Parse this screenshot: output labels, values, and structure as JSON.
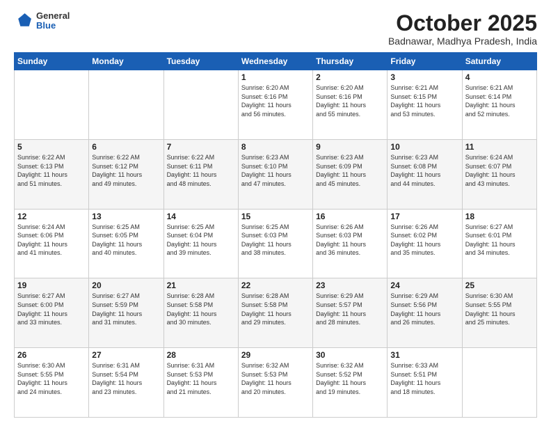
{
  "header": {
    "logo_general": "General",
    "logo_blue": "Blue",
    "month_title": "October 2025",
    "location": "Badnawar, Madhya Pradesh, India"
  },
  "days_of_week": [
    "Sunday",
    "Monday",
    "Tuesday",
    "Wednesday",
    "Thursday",
    "Friday",
    "Saturday"
  ],
  "weeks": [
    [
      {
        "day": "",
        "info": ""
      },
      {
        "day": "",
        "info": ""
      },
      {
        "day": "",
        "info": ""
      },
      {
        "day": "1",
        "info": "Sunrise: 6:20 AM\nSunset: 6:16 PM\nDaylight: 11 hours\nand 56 minutes."
      },
      {
        "day": "2",
        "info": "Sunrise: 6:20 AM\nSunset: 6:16 PM\nDaylight: 11 hours\nand 55 minutes."
      },
      {
        "day": "3",
        "info": "Sunrise: 6:21 AM\nSunset: 6:15 PM\nDaylight: 11 hours\nand 53 minutes."
      },
      {
        "day": "4",
        "info": "Sunrise: 6:21 AM\nSunset: 6:14 PM\nDaylight: 11 hours\nand 52 minutes."
      }
    ],
    [
      {
        "day": "5",
        "info": "Sunrise: 6:22 AM\nSunset: 6:13 PM\nDaylight: 11 hours\nand 51 minutes."
      },
      {
        "day": "6",
        "info": "Sunrise: 6:22 AM\nSunset: 6:12 PM\nDaylight: 11 hours\nand 49 minutes."
      },
      {
        "day": "7",
        "info": "Sunrise: 6:22 AM\nSunset: 6:11 PM\nDaylight: 11 hours\nand 48 minutes."
      },
      {
        "day": "8",
        "info": "Sunrise: 6:23 AM\nSunset: 6:10 PM\nDaylight: 11 hours\nand 47 minutes."
      },
      {
        "day": "9",
        "info": "Sunrise: 6:23 AM\nSunset: 6:09 PM\nDaylight: 11 hours\nand 45 minutes."
      },
      {
        "day": "10",
        "info": "Sunrise: 6:23 AM\nSunset: 6:08 PM\nDaylight: 11 hours\nand 44 minutes."
      },
      {
        "day": "11",
        "info": "Sunrise: 6:24 AM\nSunset: 6:07 PM\nDaylight: 11 hours\nand 43 minutes."
      }
    ],
    [
      {
        "day": "12",
        "info": "Sunrise: 6:24 AM\nSunset: 6:06 PM\nDaylight: 11 hours\nand 41 minutes."
      },
      {
        "day": "13",
        "info": "Sunrise: 6:25 AM\nSunset: 6:05 PM\nDaylight: 11 hours\nand 40 minutes."
      },
      {
        "day": "14",
        "info": "Sunrise: 6:25 AM\nSunset: 6:04 PM\nDaylight: 11 hours\nand 39 minutes."
      },
      {
        "day": "15",
        "info": "Sunrise: 6:25 AM\nSunset: 6:03 PM\nDaylight: 11 hours\nand 38 minutes."
      },
      {
        "day": "16",
        "info": "Sunrise: 6:26 AM\nSunset: 6:03 PM\nDaylight: 11 hours\nand 36 minutes."
      },
      {
        "day": "17",
        "info": "Sunrise: 6:26 AM\nSunset: 6:02 PM\nDaylight: 11 hours\nand 35 minutes."
      },
      {
        "day": "18",
        "info": "Sunrise: 6:27 AM\nSunset: 6:01 PM\nDaylight: 11 hours\nand 34 minutes."
      }
    ],
    [
      {
        "day": "19",
        "info": "Sunrise: 6:27 AM\nSunset: 6:00 PM\nDaylight: 11 hours\nand 33 minutes."
      },
      {
        "day": "20",
        "info": "Sunrise: 6:27 AM\nSunset: 5:59 PM\nDaylight: 11 hours\nand 31 minutes."
      },
      {
        "day": "21",
        "info": "Sunrise: 6:28 AM\nSunset: 5:58 PM\nDaylight: 11 hours\nand 30 minutes."
      },
      {
        "day": "22",
        "info": "Sunrise: 6:28 AM\nSunset: 5:58 PM\nDaylight: 11 hours\nand 29 minutes."
      },
      {
        "day": "23",
        "info": "Sunrise: 6:29 AM\nSunset: 5:57 PM\nDaylight: 11 hours\nand 28 minutes."
      },
      {
        "day": "24",
        "info": "Sunrise: 6:29 AM\nSunset: 5:56 PM\nDaylight: 11 hours\nand 26 minutes."
      },
      {
        "day": "25",
        "info": "Sunrise: 6:30 AM\nSunset: 5:55 PM\nDaylight: 11 hours\nand 25 minutes."
      }
    ],
    [
      {
        "day": "26",
        "info": "Sunrise: 6:30 AM\nSunset: 5:55 PM\nDaylight: 11 hours\nand 24 minutes."
      },
      {
        "day": "27",
        "info": "Sunrise: 6:31 AM\nSunset: 5:54 PM\nDaylight: 11 hours\nand 23 minutes."
      },
      {
        "day": "28",
        "info": "Sunrise: 6:31 AM\nSunset: 5:53 PM\nDaylight: 11 hours\nand 21 minutes."
      },
      {
        "day": "29",
        "info": "Sunrise: 6:32 AM\nSunset: 5:53 PM\nDaylight: 11 hours\nand 20 minutes."
      },
      {
        "day": "30",
        "info": "Sunrise: 6:32 AM\nSunset: 5:52 PM\nDaylight: 11 hours\nand 19 minutes."
      },
      {
        "day": "31",
        "info": "Sunrise: 6:33 AM\nSunset: 5:51 PM\nDaylight: 11 hours\nand 18 minutes."
      },
      {
        "day": "",
        "info": ""
      }
    ]
  ]
}
